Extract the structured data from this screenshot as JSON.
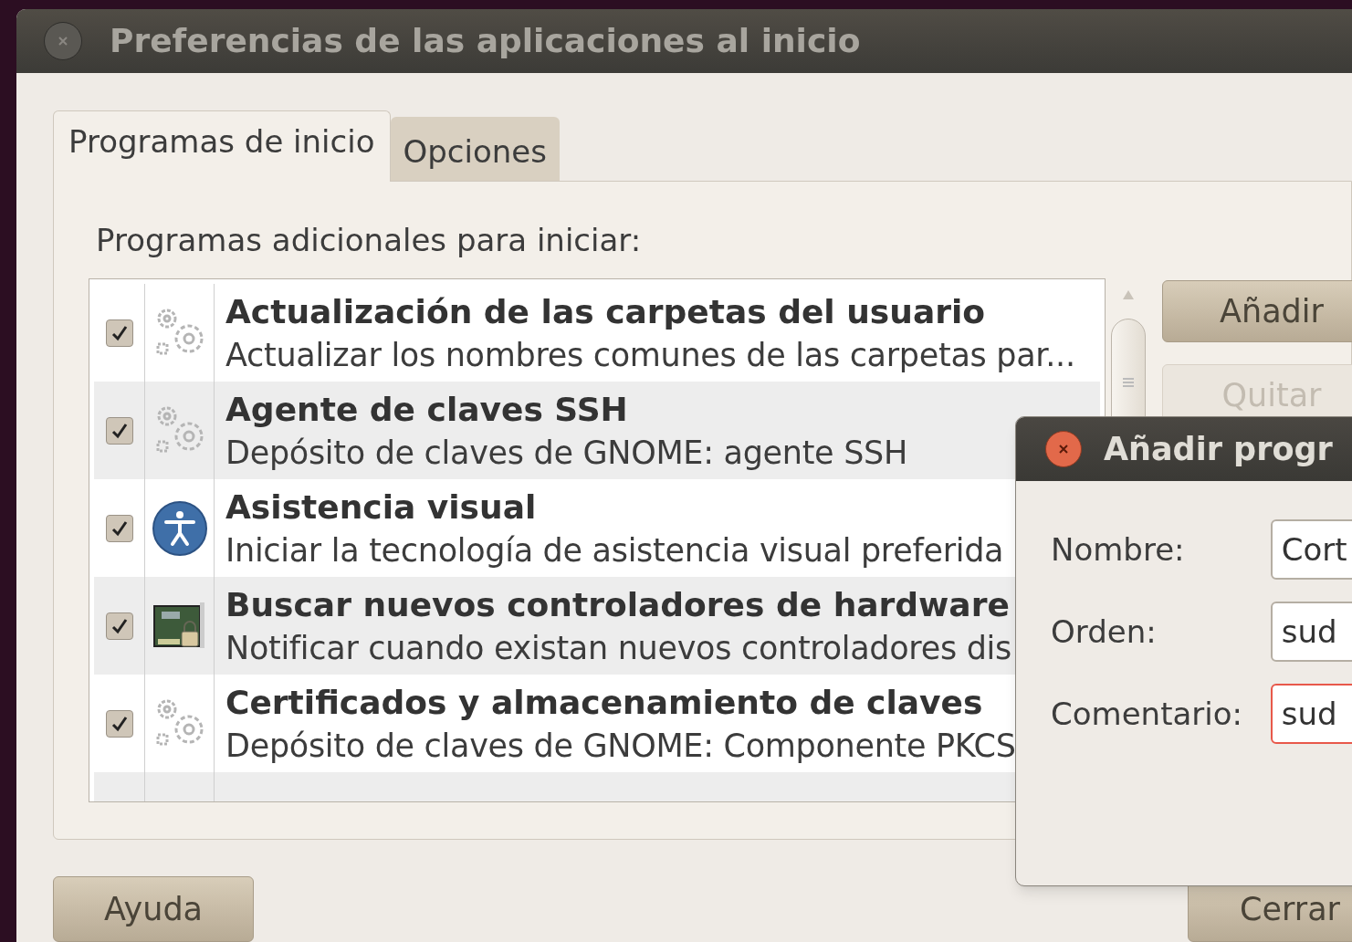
{
  "window": {
    "title": "Preferencias de las aplicaciones al inicio"
  },
  "tabs": [
    {
      "label": "Programas de inicio",
      "selected": true
    },
    {
      "label": "Opciones",
      "selected": false
    }
  ],
  "list_label": "Programas adicionales para iniciar:",
  "programs": [
    {
      "checked": true,
      "kind": "gears",
      "title": "Actualización de las carpetas del usuario",
      "description": "Actualizar los nombres comunes de las carpetas par..."
    },
    {
      "checked": true,
      "kind": "gears",
      "title": "Agente de claves SSH",
      "description": "Depósito de claves de GNOME: agente SSH"
    },
    {
      "checked": true,
      "kind": "accessibility",
      "title": "Asistencia visual",
      "description": "Iniciar la tecnología de asistencia visual preferida"
    },
    {
      "checked": true,
      "kind": "hardware",
      "title": "Buscar nuevos controladores de hardware",
      "description": "Notificar cuando existan nuevos controladores dis"
    },
    {
      "checked": true,
      "kind": "gears",
      "title": "Certificados y almacenamiento de claves",
      "description": "Depósito de claves de GNOME: Componente PKCS"
    },
    {
      "kind": "partial"
    }
  ],
  "side_buttons": [
    {
      "label": "Añadir",
      "disabled": false
    },
    {
      "label": "Quitar",
      "disabled": true
    }
  ],
  "help_button": "Ayuda",
  "close_button": "Cerrar",
  "dialog": {
    "title": "Añadir progr",
    "fields": [
      {
        "label": "Nombre:",
        "value": "Cort",
        "invalid": false
      },
      {
        "label": "Orden:",
        "value": "sud",
        "invalid": false
      },
      {
        "label": "Comentario:",
        "value": "sud",
        "invalid": true
      }
    ]
  }
}
